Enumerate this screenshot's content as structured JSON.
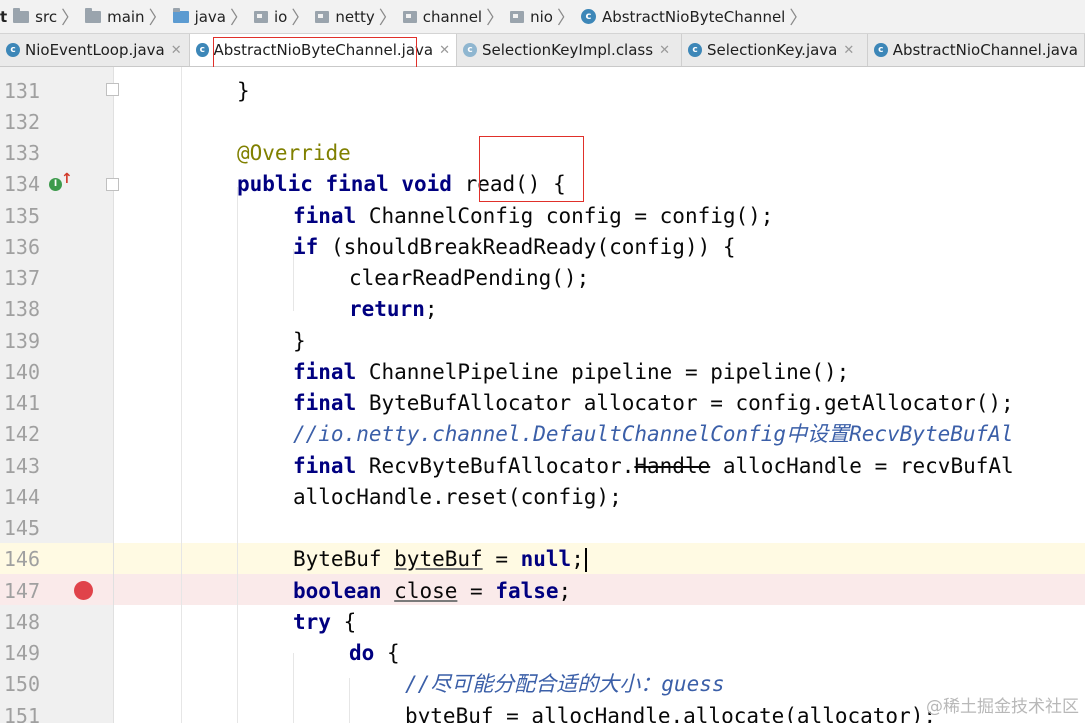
{
  "breadcrumb": {
    "items": [
      {
        "label": "t",
        "icon": "none"
      },
      {
        "label": "src",
        "icon": "folder-icon"
      },
      {
        "label": "main",
        "icon": "folder-icon"
      },
      {
        "label": "java",
        "icon": "folder-icon"
      },
      {
        "label": "io",
        "icon": "package-icon"
      },
      {
        "label": "netty",
        "icon": "package-icon"
      },
      {
        "label": "channel",
        "icon": "package-icon"
      },
      {
        "label": "nio",
        "icon": "package-icon"
      },
      {
        "label": "AbstractNioByteChannel",
        "icon": "class-icon"
      }
    ]
  },
  "tabs": [
    {
      "label": "NioEventLoop.java",
      "active": false
    },
    {
      "label": "AbstractNioByteChannel.java",
      "active": true
    },
    {
      "label": "SelectionKeyImpl.class",
      "active": false
    },
    {
      "label": "SelectionKey.java",
      "active": false
    },
    {
      "label": "AbstractNioChannel.java",
      "active": false
    }
  ],
  "editor": {
    "lines": [
      {
        "num": "131"
      },
      {
        "num": "132"
      },
      {
        "num": "133"
      },
      {
        "num": "134"
      },
      {
        "num": "135"
      },
      {
        "num": "136"
      },
      {
        "num": "137"
      },
      {
        "num": "138"
      },
      {
        "num": "139"
      },
      {
        "num": "140"
      },
      {
        "num": "141"
      },
      {
        "num": "142"
      },
      {
        "num": "143"
      },
      {
        "num": "144"
      },
      {
        "num": "145"
      },
      {
        "num": "146"
      },
      {
        "num": "147"
      },
      {
        "num": "148"
      },
      {
        "num": "149"
      },
      {
        "num": "150"
      },
      {
        "num": "151"
      }
    ],
    "code": {
      "l131": "}",
      "l133": "@Override",
      "l134_kw": "public final void",
      "l134_name": "read()",
      "l134_rest": " {",
      "l135_kw": "final",
      "l135_rest": " ChannelConfig config = config();",
      "l136_kw": "if",
      "l136_rest": " (shouldBreakReadReady(config)) {",
      "l137": "clearReadPending();",
      "l138_kw": "return",
      "l138_rest": ";",
      "l139": "}",
      "l140_kw": "final",
      "l140_rest": " ChannelPipeline pipeline = pipeline();",
      "l141_kw": "final",
      "l141_rest": " ByteBufAllocator allocator = config.getAllocator();",
      "l142": "//io.netty.channel.DefaultChannelConfig中设置RecvByteBufAl",
      "l143_kw": "final",
      "l143_a": " RecvByteBufAllocator.",
      "l143_strike": "Handle",
      "l143_b": " allocHandle = recvBufAl",
      "l144": "allocHandle.reset(config);",
      "l146_a": "ByteBuf ",
      "l146_var": "byteBuf",
      "l146_b": " = ",
      "l146_kw": "null",
      "l146_c": ";",
      "l147_kw": "boolean",
      "l147_a": " ",
      "l147_var": "close",
      "l147_b": " = ",
      "l147_kw2": "false",
      "l147_c": ";",
      "l148_kw": "try",
      "l148_rest": " {",
      "l149_kw": "do",
      "l149_rest": " {",
      "l150": "//尽可能分配合适的大小：guess",
      "l151": "byteBuf = allocHandle.allocate(allocator);"
    }
  },
  "watermark": "@稀土掘金技术社区",
  "colors": {
    "keyword": "#000080",
    "annotation": "#808000",
    "comment": "#808080",
    "breakpoint": "#e0434a",
    "caret_line": "#fffae3",
    "breakpoint_line": "#faeaea",
    "highlight_box": "#e0302a"
  }
}
